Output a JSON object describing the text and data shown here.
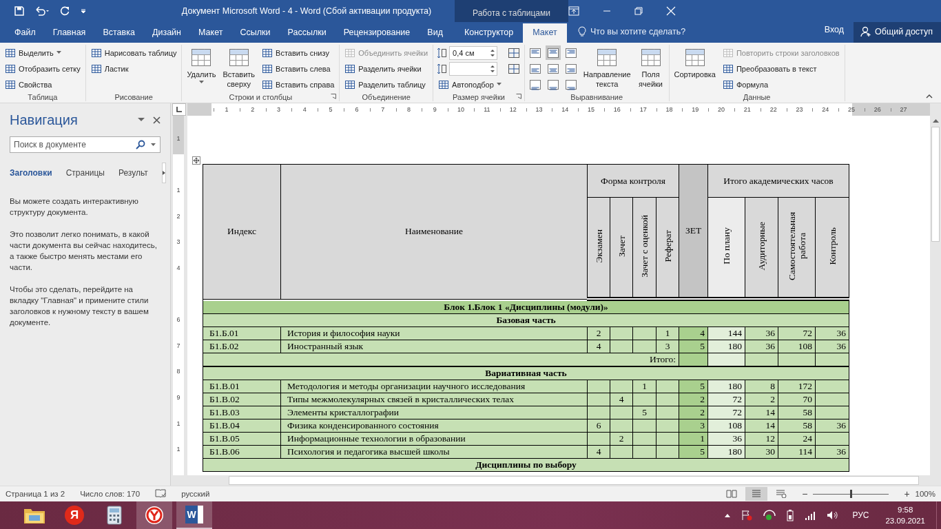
{
  "title_bar": {
    "title": "Документ Microsoft Word - 4 - Word (Сбой активации продукта)",
    "context_label": "Работа с таблицами"
  },
  "tabs": [
    {
      "label": "Файл",
      "kind": "main",
      "selected": false
    },
    {
      "label": "Главная",
      "kind": "main",
      "selected": false
    },
    {
      "label": "Вставка",
      "kind": "main",
      "selected": false
    },
    {
      "label": "Дизайн",
      "kind": "main",
      "selected": false
    },
    {
      "label": "Макет",
      "kind": "main",
      "selected": false
    },
    {
      "label": "Ссылки",
      "kind": "main",
      "selected": false
    },
    {
      "label": "Рассылки",
      "kind": "main",
      "selected": false
    },
    {
      "label": "Рецензирование",
      "kind": "main",
      "selected": false
    },
    {
      "label": "Вид",
      "kind": "main",
      "selected": false
    },
    {
      "label": "Конструктор",
      "kind": "context",
      "selected": false
    },
    {
      "label": "Макет",
      "kind": "context",
      "selected": true
    }
  ],
  "tell_me": {
    "placeholder": "Что вы хотите сделать?"
  },
  "account": {
    "sign_in": "Вход",
    "share": "Общий доступ"
  },
  "ribbon": {
    "groups": [
      {
        "label": "Таблица",
        "launcher": false,
        "items": [
          {
            "kind": "small",
            "text": "Выделить",
            "dropdown": true,
            "disabled": false
          },
          {
            "kind": "small",
            "text": "Отобразить сетку",
            "dropdown": false,
            "disabled": false
          },
          {
            "kind": "small",
            "text": "Свойства",
            "dropdown": false,
            "disabled": false
          }
        ]
      },
      {
        "label": "Рисование",
        "launcher": false,
        "items": [
          {
            "kind": "small",
            "text": "Нарисовать таблицу",
            "dropdown": false,
            "disabled": false
          },
          {
            "kind": "small",
            "text": "Ластик",
            "dropdown": false,
            "disabled": false
          }
        ]
      },
      {
        "label": "Строки и столбцы",
        "launcher": true,
        "items": [
          {
            "kind": "large",
            "text": "Удалить",
            "dropdown": true,
            "disabled": false
          },
          {
            "kind": "large",
            "text": "Вставить сверху",
            "dropdown": false,
            "disabled": false
          },
          {
            "kind": "small",
            "text": "Вставить снизу",
            "dropdown": false,
            "disabled": false
          },
          {
            "kind": "small",
            "text": "Вставить слева",
            "dropdown": false,
            "disabled": false
          },
          {
            "kind": "small",
            "text": "Вставить справа",
            "dropdown": false,
            "disabled": false
          }
        ]
      },
      {
        "label": "Объединение",
        "launcher": false,
        "items": [
          {
            "kind": "small",
            "text": "Объединить ячейки",
            "dropdown": false,
            "disabled": true
          },
          {
            "kind": "small",
            "text": "Разделить ячейки",
            "dropdown": false,
            "disabled": false
          },
          {
            "kind": "small",
            "text": "Разделить таблицу",
            "dropdown": false,
            "disabled": false
          }
        ]
      },
      {
        "label": "Размер ячейки",
        "launcher": true,
        "items": [
          {
            "kind": "spin",
            "value": "0,4 см"
          },
          {
            "kind": "spin"
          },
          {
            "kind": "small",
            "text": "Автоподбор",
            "dropdown": true,
            "disabled": false
          },
          {
            "kind": "icon"
          },
          {
            "kind": "icon"
          }
        ]
      },
      {
        "label": "Выравнивание",
        "launcher": false,
        "items": [
          {
            "kind": "align",
            "selected": false
          },
          {
            "kind": "align",
            "selected": false
          },
          {
            "kind": "align",
            "selected": false
          },
          {
            "kind": "align",
            "selected": true
          },
          {
            "kind": "align",
            "selected": false
          },
          {
            "kind": "align",
            "selected": false
          },
          {
            "kind": "align",
            "selected": false
          },
          {
            "kind": "align",
            "selected": false
          },
          {
            "kind": "align",
            "selected": false
          },
          {
            "kind": "large",
            "text": "Направление текста",
            "dropdown": false,
            "disabled": false
          },
          {
            "kind": "large",
            "text": "Поля ячейки",
            "dropdown": false,
            "disabled": false
          }
        ]
      },
      {
        "label": "Данные",
        "launcher": false,
        "items": [
          {
            "kind": "large",
            "text": "Сортировка",
            "dropdown": false,
            "disabled": false
          },
          {
            "kind": "small",
            "text": "Повторить строки заголовков",
            "dropdown": false,
            "disabled": true
          },
          {
            "kind": "small",
            "text": "Преобразовать в текст",
            "dropdown": false,
            "disabled": false
          },
          {
            "kind": "small",
            "text": "Формула",
            "dropdown": false,
            "disabled": false
          }
        ]
      }
    ]
  },
  "navigation": {
    "title": "Навигация",
    "search": {
      "placeholder": "Поиск в документе"
    },
    "tabs": [
      {
        "label": "Заголовки",
        "selected": true
      },
      {
        "label": "Страницы",
        "selected": false
      },
      {
        "label": "Результ",
        "selected": false
      }
    ],
    "paragraphs": [
      "Вы можете создать интерактивную структуру документа.",
      "Это позволит легко понимать, в какой части документа вы сейчас находитесь, а также быстро менять местами его части.",
      "Чтобы это сделать, перейдите на вкладку \"Главная\" и примените стили заголовков к нужному тексту в вашем документе."
    ]
  },
  "ruler": {
    "horizontal": [
      "1",
      "2",
      "3",
      "4",
      "5",
      "6",
      "7",
      "8",
      "9",
      "10",
      "11",
      "12",
      "13",
      "14",
      "15",
      "16",
      "17",
      "18",
      "19",
      "20",
      "21",
      "22",
      "23",
      "24",
      "25",
      "26",
      "27"
    ],
    "vertical": [
      "1",
      "1",
      "2",
      "3",
      "4",
      "6",
      "7",
      "8",
      "9",
      "1",
      "1"
    ]
  },
  "table": {
    "header": {
      "index": "Индекс",
      "name": "Наименование",
      "control_group": "Форма контроля",
      "control": [
        "Экзамен",
        "Зачет",
        "Зачет с оценкой",
        "Реферат"
      ],
      "zet": "ЗЕТ",
      "hours_group": "Итого академических часов",
      "hours": [
        "По плану",
        "Аудиторные",
        "Самостоятельная работа",
        "Контроль"
      ]
    },
    "rows": [
      {
        "kind": "block",
        "text": "Блок 1.Блок 1 «Дисциплины (модули)»"
      },
      {
        "kind": "section",
        "text": "Базовая часть"
      },
      {
        "kind": "row",
        "cells": [
          "Б1.Б.01",
          "История и философия науки",
          "2",
          null,
          null,
          "1",
          "4",
          "144",
          "36",
          "72",
          "36"
        ]
      },
      {
        "kind": "row",
        "cells": [
          "Б1.Б.02",
          "Иностранный язык",
          "4",
          null,
          null,
          "3",
          "5",
          "180",
          "36",
          "108",
          "36"
        ]
      },
      {
        "kind": "total",
        "label": "Итого:"
      },
      {
        "kind": "section",
        "text": "Вариативная часть"
      },
      {
        "kind": "row",
        "cells": [
          "Б1.В.01",
          "Методология и методы организации научного исследования",
          null,
          null,
          "1",
          null,
          "5",
          "180",
          "8",
          "172",
          null
        ]
      },
      {
        "kind": "row",
        "cells": [
          "Б1.В.02",
          "Типы межмолекулярных связей в кристаллических телах",
          null,
          "4",
          null,
          null,
          "2",
          "72",
          "2",
          "70",
          null
        ]
      },
      {
        "kind": "row",
        "cells": [
          "Б1.В.03",
          "Элементы кристаллографии",
          null,
          null,
          "5",
          null,
          "2",
          "72",
          "14",
          "58",
          null
        ]
      },
      {
        "kind": "row",
        "cells": [
          "Б1.В.04",
          "Физика конденсированного состояния",
          "6",
          null,
          null,
          null,
          "3",
          "108",
          "14",
          "58",
          "36"
        ]
      },
      {
        "kind": "row",
        "cells": [
          "Б1.В.05",
          "Информационные технологии в образовании",
          null,
          "2",
          null,
          null,
          "1",
          "36",
          "12",
          "24",
          null
        ]
      },
      {
        "kind": "row",
        "cells": [
          "Б1.В.06",
          "Психология и педагогика высшей школы",
          "4",
          null,
          null,
          null,
          "5",
          "180",
          "30",
          "114",
          "36"
        ]
      },
      {
        "kind": "section",
        "text": "Дисциплины по выбору"
      }
    ]
  },
  "status_bar": {
    "page": "Страница 1 из 2",
    "words": "Число слов: 170",
    "language": "русский",
    "zoom_minus": "−",
    "zoom_plus": "+",
    "level": 0.5,
    "zoom": "100%"
  },
  "taskbar": {
    "apps": [
      {
        "kind": "folder",
        "selected": false
      },
      {
        "kind": "yandex",
        "label": "Я",
        "selected": false
      },
      {
        "kind": "calculator",
        "selected": false
      },
      {
        "kind": "browser",
        "selected": true
      },
      {
        "kind": "word",
        "label": "W",
        "selected": true
      }
    ],
    "language": "РУС",
    "time": "9:58",
    "date": "23.09.2021"
  }
}
